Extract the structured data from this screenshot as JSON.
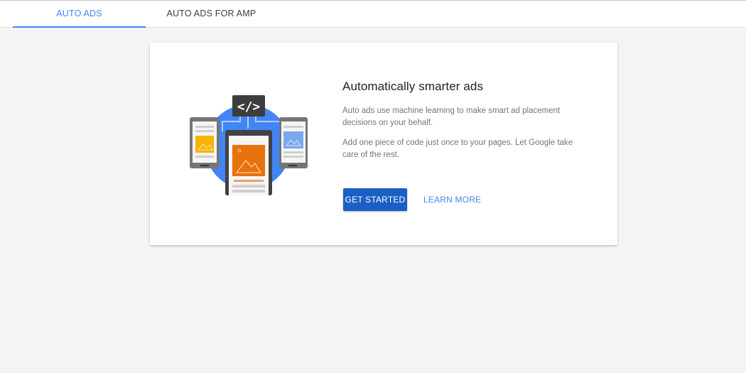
{
  "tabs": [
    {
      "label": "AUTO ADS",
      "active": true
    },
    {
      "label": "AUTO ADS FOR AMP",
      "active": false
    }
  ],
  "card": {
    "illustration_icon": "code-devices-illustration",
    "code_symbol": "</>",
    "title": "Automatically smarter ads",
    "paragraph1": "Auto ads use machine learning to make smart ad placement decisions on your behalf.",
    "paragraph2": "Add one piece of code just once to your pages. Let Google take care of the rest.",
    "primary_button": "GET STARTED",
    "secondary_button": "LEARN MORE"
  },
  "colors": {
    "accent": "#4285f4",
    "primary_button": "#1a5fc4",
    "background": "#f4f4f4"
  }
}
